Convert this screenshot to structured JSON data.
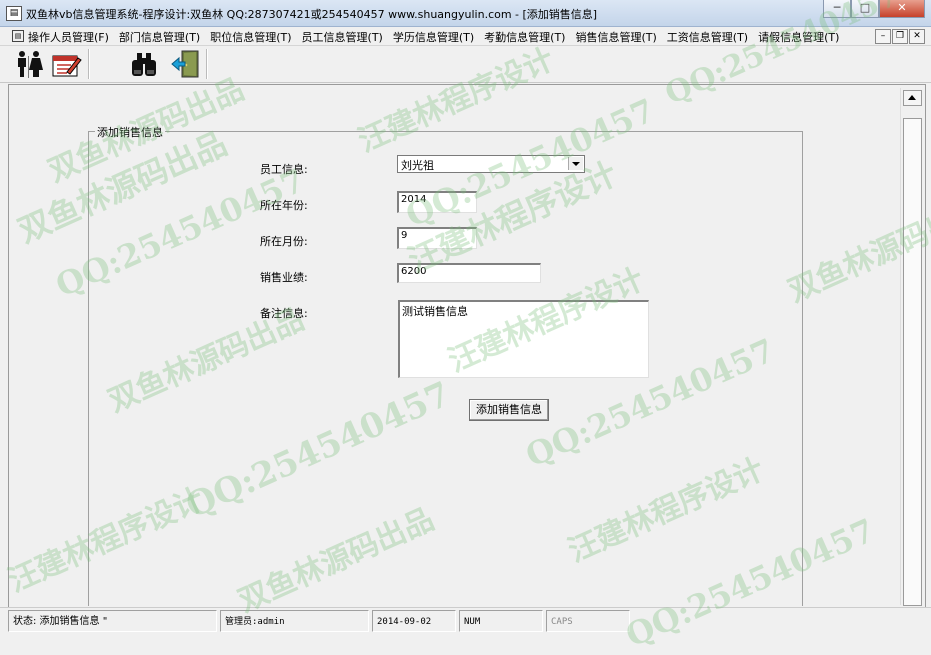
{
  "window": {
    "title": "双鱼林vb信息管理系统-程序设计:双鱼林 QQ:287307421或254540457 www.shuangyulin.com - [添加销售信息]",
    "minimize": "─",
    "maximize": "□",
    "close": "✕"
  },
  "menu": [
    "操作人员管理(F)",
    "部门信息管理(T)",
    "职位信息管理(T)",
    "员工信息管理(T)",
    "学历信息管理(T)",
    "考勤信息管理(T)",
    "销售信息管理(T)",
    "工资信息管理(T)",
    "请假信息管理(T)"
  ],
  "toolbar": {
    "icons": [
      "people-icon",
      "notepad-icon",
      "binoculars-icon",
      "exit-door-icon"
    ]
  },
  "form": {
    "frame_title": "添加销售信息",
    "employee_label": "员工信息:",
    "employee_value": "刘光祖",
    "year_label": "所在年份:",
    "year_value": "2014",
    "month_label": "所在月份:",
    "month_value": "9",
    "sales_label": "销售业绩:",
    "sales_value": "6200",
    "remark_label": "备注信息:",
    "remark_value": "测试销售信息",
    "submit_label": "添加销售信息"
  },
  "status": {
    "state": "状态: 添加销售信息 \"",
    "admin": "管理员:admin",
    "date": "2014-09-02",
    "num": "NUM",
    "caps": "CAPS"
  },
  "watermarks": [
    "双鱼林源码出品",
    "汪建林程序设计",
    "QQ:254540457",
    "双鱼林源码出品",
    "QQ:254540457",
    "汪建林程序设计",
    "QQ:254540457",
    "双鱼林源码出品",
    "汪建林程序设计",
    "QQ:254540457",
    "汪建林程序设计",
    "双鱼林源码出品",
    "QQ:254540457",
    "双鱼林源码出品",
    "汪建林程序设计",
    "QQ:254540457"
  ]
}
